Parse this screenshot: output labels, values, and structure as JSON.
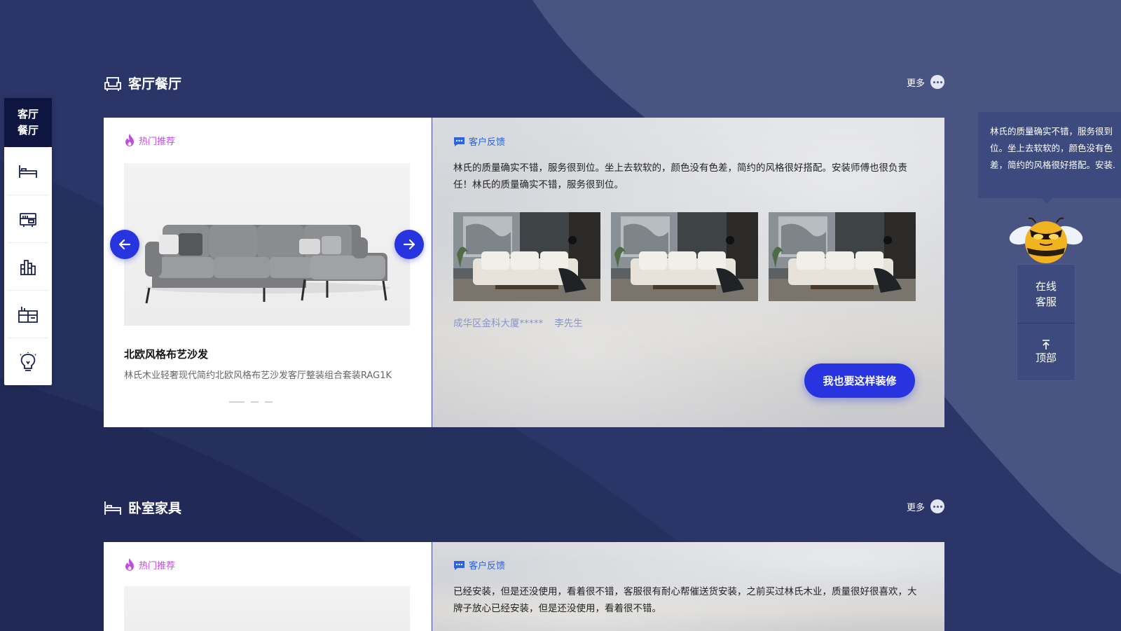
{
  "sidebar": {
    "active_line1": "客厅",
    "active_line2": "餐厅",
    "items": [
      {
        "icon": "bed-icon"
      },
      {
        "icon": "tv-cabinet-icon"
      },
      {
        "icon": "bookshelf-icon"
      },
      {
        "icon": "cabinet-icon"
      },
      {
        "icon": "lightbulb-icon"
      }
    ]
  },
  "sections": [
    {
      "title": "客厅餐厅",
      "icon": "sofa-icon",
      "more": "更多",
      "hot_tag": "热门推荐",
      "product": {
        "name": "北欧风格布艺沙发",
        "description": "林氏木业轻奢现代简约北欧风格布艺沙发客厅整装组合套装RAG1K"
      },
      "feedback_tag": "客户反馈",
      "feedback_text": "林氏的质量确实不错，服务很到位。坐上去软软的，颜色没有色差，简约的风格很好搭配。安装师傅也很负责任！林氏的质量确实不错，服务很到位。",
      "location": "成华区金科大厦*****",
      "customer": "李先生",
      "cta": "我也要这样装修"
    },
    {
      "title": "卧室家具",
      "icon": "bed-icon",
      "more": "更多",
      "hot_tag": "热门推荐",
      "feedback_tag": "客户反馈",
      "feedback_text": "已经安装，但是还没使用，看着很不错，客服很有耐心帮催送货安装，之前买过林氏木业，质量很好很喜欢，大牌子放心已经安装，但是还没使用，看着很不错。"
    }
  ],
  "tooltip": {
    "text": "林氏的质量确实不错，服务很到位。坐上去软软的，颜色没有色差，简约的风格很好搭配。安装."
  },
  "service": {
    "online_line1": "在线",
    "online_line2": "客服",
    "top_icon": "arrow-to-top-icon",
    "top_label": "顶部"
  },
  "colors": {
    "background": "#2a3462",
    "accent": "#2734e0",
    "hot": "#c14de0",
    "feedback": "#2a62e0",
    "panel": "#3d4a7d"
  }
}
